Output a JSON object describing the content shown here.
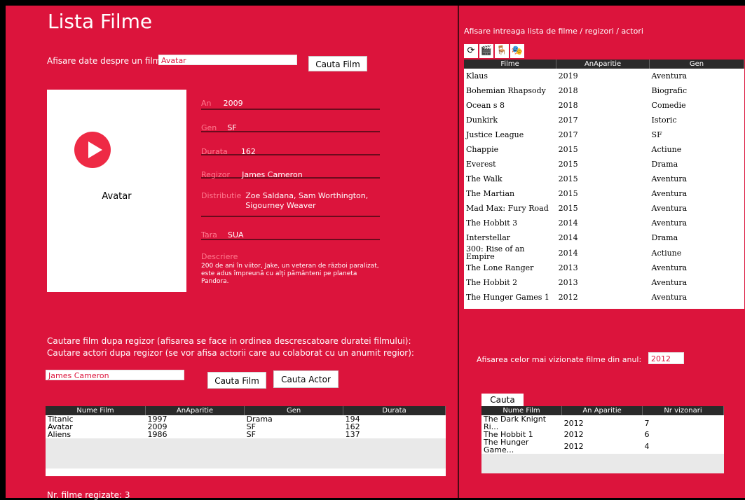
{
  "title": "Lista Filme",
  "search": {
    "label": "Afisare date despre un film:",
    "value": "Avatar",
    "button": "Cauta Film"
  },
  "poster": {
    "name": "Avatar",
    "play_color": "#ee2a45"
  },
  "details": {
    "an": {
      "key": "An",
      "value": "2009"
    },
    "gen": {
      "key": "Gen",
      "value": "SF"
    },
    "durata": {
      "key": "Durata",
      "value": "162"
    },
    "regizor": {
      "key": "Regizor",
      "value": "James Cameron"
    },
    "distributie": {
      "key": "Distributie",
      "value": "Zoe Saldana, Sam Worthington, Sigourney Weaver"
    },
    "tara": {
      "key": "Tara",
      "value": "SUA"
    },
    "descriere": {
      "key": "Descriere",
      "value": "200 de ani în viitor, Jake, un veteran de război paralizat, este adus împreună cu alţi pământeni pe planeta Pandora."
    }
  },
  "regizor_search": {
    "line1": "Cautare film dupa regizor (afisarea se face in ordinea descrescatoare duratei filmului):",
    "line2": "Cautare actori dupa regizor (se vor afisa actorii care au colaborat cu un anumit regior):",
    "value": "James Cameron",
    "btn_film": "Cauta Film",
    "btn_actor": "Cauta Actor"
  },
  "director_table": {
    "headers": [
      "Nume Film",
      "AnAparitie",
      "Gen",
      "Durata"
    ],
    "rows": [
      [
        "Titanic",
        "1997",
        "Drama",
        "194"
      ],
      [
        "Avatar",
        "2009",
        "SF",
        "162"
      ],
      [
        "Aliens",
        "1986",
        "SF",
        "137"
      ]
    ]
  },
  "count_label": "Nr. filme regizate:  3",
  "right": {
    "header": "Afisare intreaga lista de filme / regizori / actori",
    "icons": [
      "refresh-icon",
      "clapperboard-icon",
      "director-chair-icon",
      "masks-icon"
    ],
    "films_headers": [
      "Filme",
      "AnAparitie",
      "Gen"
    ],
    "films": [
      [
        "Klaus",
        "2019",
        "Aventura"
      ],
      [
        "Bohemian Rhapsody",
        "2018",
        "Biografic"
      ],
      [
        "Ocean s 8",
        "2018",
        "Comedie"
      ],
      [
        "Dunkirk",
        "2017",
        "Istoric"
      ],
      [
        "Justice League",
        "2017",
        "SF"
      ],
      [
        "Chappie",
        "2015",
        "Actiune"
      ],
      [
        "Everest",
        "2015",
        "Drama"
      ],
      [
        "The Walk",
        "2015",
        "Aventura"
      ],
      [
        "The Martian",
        "2015",
        "Aventura"
      ],
      [
        "Mad Max: Fury Road",
        "2015",
        "Aventura"
      ],
      [
        "The Hobbit 3",
        "2014",
        "Aventura"
      ],
      [
        "Interstellar",
        "2014",
        "Drama"
      ],
      [
        "300: Rise of an Empire",
        "2014",
        "Actiune"
      ],
      [
        "The Lone Ranger",
        "2013",
        "Aventura"
      ],
      [
        "The Hobbit 2",
        "2013",
        "Aventura"
      ],
      [
        "The Hunger Games 1",
        "2012",
        "Aventura"
      ]
    ],
    "popular_label": "Afisarea celor mai vizionate filme din anul:",
    "popular_year": "2012",
    "popular_btn": "Cauta",
    "popular_headers": [
      "Nume Film",
      "An Aparitie",
      "Nr vizonari"
    ],
    "popular_rows": [
      [
        "The Dark Knignt Ri...",
        "2012",
        "7"
      ],
      [
        "The Hobbit 1",
        "2012",
        "6"
      ],
      [
        "The Hunger Game...",
        "2012",
        "4"
      ]
    ]
  },
  "colors": {
    "background": "#dc143c",
    "header": "#2a2a2a",
    "accent_text": "#ff7a8f"
  }
}
